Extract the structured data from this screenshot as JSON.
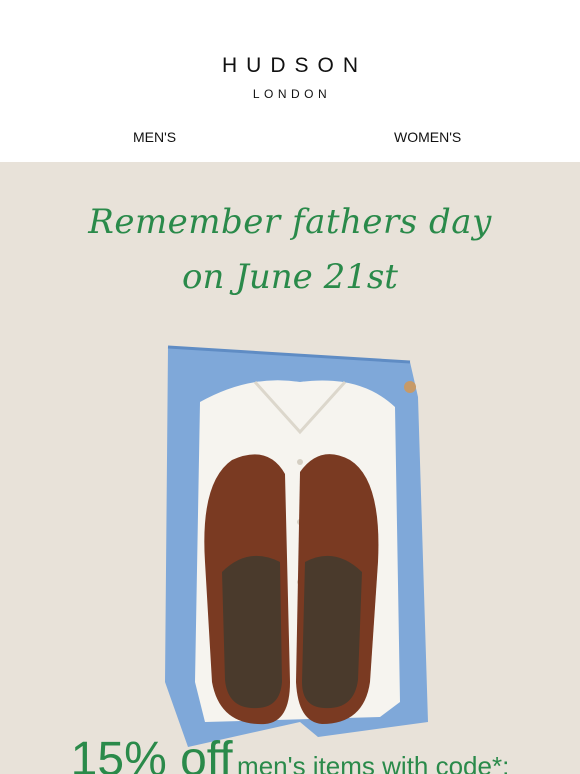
{
  "brand": {
    "name": "HUDSON",
    "sub": "LONDON"
  },
  "nav": {
    "men": "MEN'S",
    "women": "WOMEN'S"
  },
  "hero": {
    "line1": "Remember fathers day",
    "line2": "on June 21st",
    "promo_big": "15% off",
    "promo_small": "men's items with code*:"
  },
  "colors": {
    "background": "#e8e2d9",
    "accent": "#2a8a4a",
    "shorts": "#7fa8d9",
    "shirt": "#f6f4ef",
    "shoe": "#7a3a22"
  }
}
